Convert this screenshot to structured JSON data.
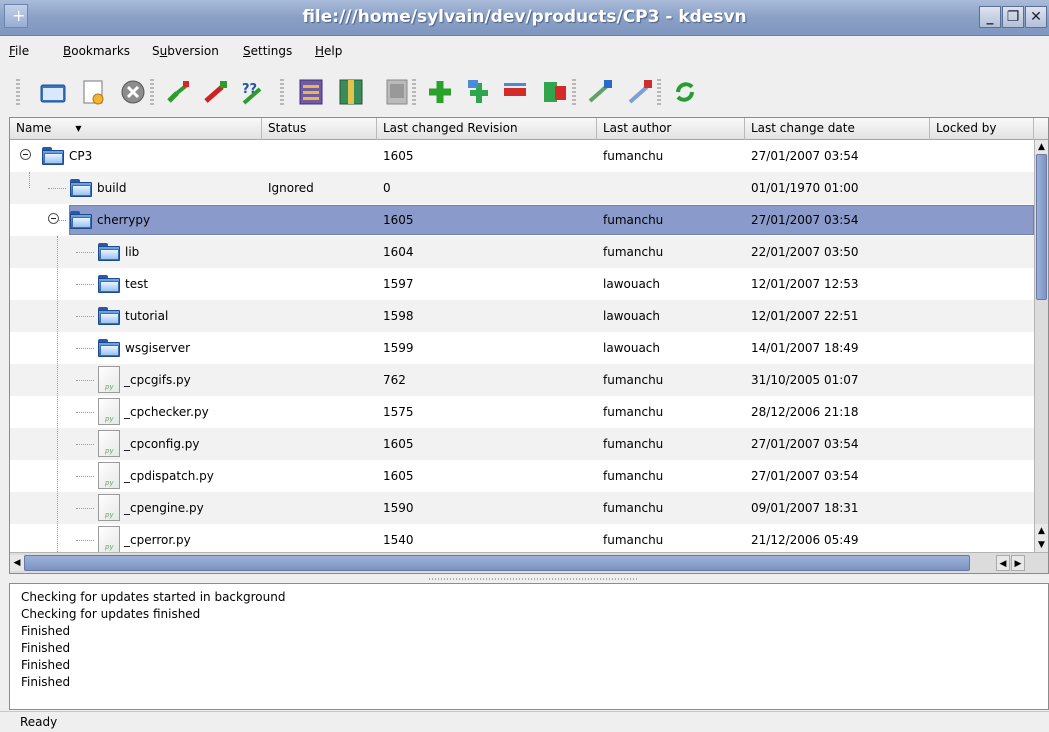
{
  "window": {
    "title": "file:///home/sylvain/dev/products/CP3 - kdesvn"
  },
  "menu": [
    {
      "label": "File",
      "mnemonic": "F",
      "rest": "ile"
    },
    {
      "label": "Bookmarks",
      "mnemonic": "B",
      "rest": "ookmarks"
    },
    {
      "label": "Subversion",
      "pre": "S",
      "mnemonic": "u",
      "rest": "bversion"
    },
    {
      "label": "Settings",
      "mnemonic": "S",
      "rest": "ettings"
    },
    {
      "label": "Help",
      "mnemonic": "H",
      "rest": "elp"
    }
  ],
  "toolbar": {
    "icons": [
      "open-folder-icon",
      "new-file-icon",
      "stop-icon",
      "update-icon",
      "commit-icon",
      "diff-icon",
      "log-icon",
      "blame-icon",
      "info-icon",
      "add-icon",
      "move-icon",
      "delete-icon",
      "copy-icon",
      "switch-icon",
      "relocate-icon",
      "refresh-icon"
    ]
  },
  "columns": [
    "Name",
    "Status",
    "Last changed Revision",
    "Last author",
    "Last change date",
    "Locked by"
  ],
  "rows": [
    {
      "name": "CP3",
      "type": "folder",
      "depth": 0,
      "expanded": true,
      "status": "",
      "revision": "1605",
      "author": "fumanchu",
      "date": "27/01/2007 03:54"
    },
    {
      "name": "build",
      "type": "folder",
      "depth": 1,
      "status": "Ignored",
      "revision": "0",
      "author": "",
      "date": "01/01/1970 01:00"
    },
    {
      "name": "cherrypy",
      "type": "folder",
      "depth": 1,
      "expanded": true,
      "selected": true,
      "status": "",
      "revision": "1605",
      "author": "fumanchu",
      "date": "27/01/2007 03:54"
    },
    {
      "name": "lib",
      "type": "folder",
      "depth": 2,
      "status": "",
      "revision": "1604",
      "author": "fumanchu",
      "date": "22/01/2007 03:50"
    },
    {
      "name": "test",
      "type": "folder",
      "depth": 2,
      "status": "",
      "revision": "1597",
      "author": "lawouach",
      "date": "12/01/2007 12:53"
    },
    {
      "name": "tutorial",
      "type": "folder",
      "depth": 2,
      "status": "",
      "revision": "1598",
      "author": "lawouach",
      "date": "12/01/2007 22:51"
    },
    {
      "name": "wsgiserver",
      "type": "folder",
      "depth": 2,
      "status": "",
      "revision": "1599",
      "author": "lawouach",
      "date": "14/01/2007 18:49"
    },
    {
      "name": "_cpcgifs.py",
      "type": "file",
      "depth": 2,
      "status": "",
      "revision": "762",
      "author": "fumanchu",
      "date": "31/10/2005 01:07"
    },
    {
      "name": "_cpchecker.py",
      "type": "file",
      "depth": 2,
      "status": "",
      "revision": "1575",
      "author": "fumanchu",
      "date": "28/12/2006 21:18"
    },
    {
      "name": "_cpconfig.py",
      "type": "file",
      "depth": 2,
      "status": "",
      "revision": "1605",
      "author": "fumanchu",
      "date": "27/01/2007 03:54"
    },
    {
      "name": "_cpdispatch.py",
      "type": "file",
      "depth": 2,
      "status": "",
      "revision": "1605",
      "author": "fumanchu",
      "date": "27/01/2007 03:54"
    },
    {
      "name": "_cpengine.py",
      "type": "file",
      "depth": 2,
      "status": "",
      "revision": "1590",
      "author": "fumanchu",
      "date": "09/01/2007 18:31"
    },
    {
      "name": "_cperror.py",
      "type": "file",
      "depth": 2,
      "status": "",
      "revision": "1540",
      "author": "fumanchu",
      "date": "21/12/2006 05:49"
    }
  ],
  "log": [
    "Checking for updates started in background",
    "Checking for updates finished",
    "Finished",
    "Finished",
    "Finished",
    "Finished"
  ],
  "status": {
    "text": "Ready"
  },
  "colors": {
    "selection": "#8a9bcb",
    "folder": "#2b63b5",
    "titlebar": "#8aa0c6"
  }
}
